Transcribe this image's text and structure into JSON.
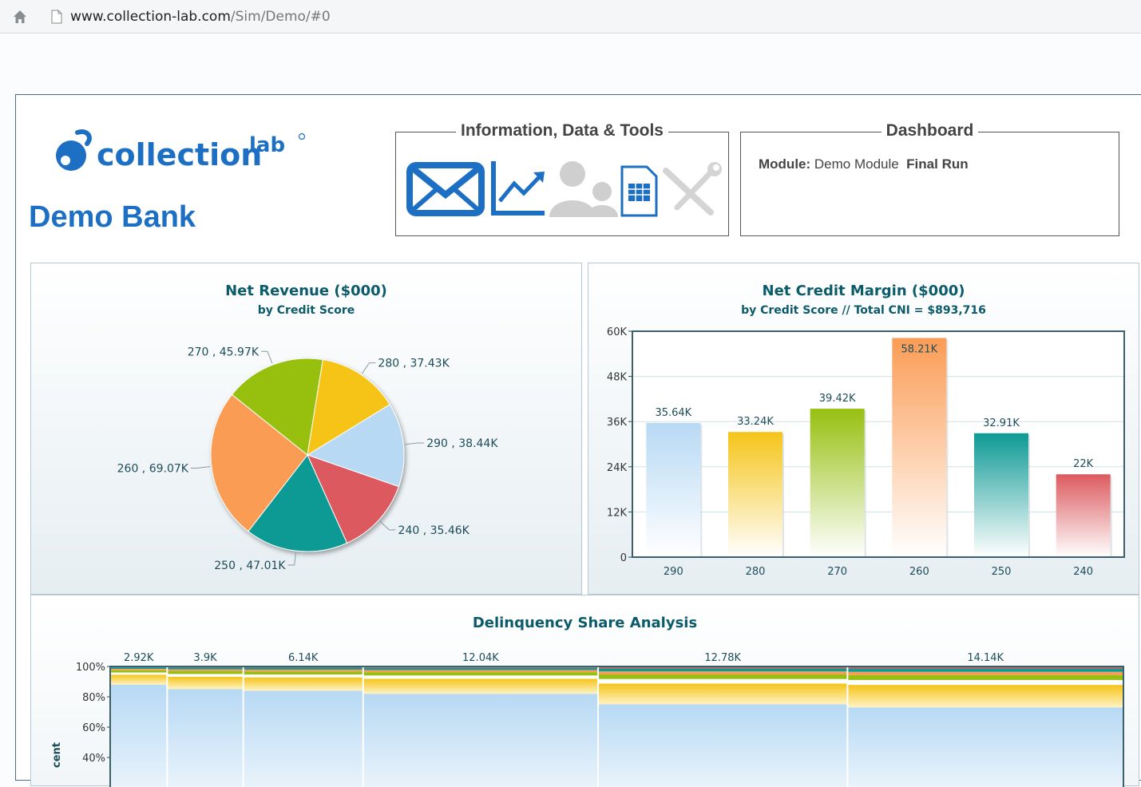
{
  "browser": {
    "url_domain": "www.collection-lab.com",
    "url_path": "/Sim/Demo/#0"
  },
  "header": {
    "logo_text": "collection",
    "logo_sup": "lab",
    "bank_name": "Demo Bank",
    "info_title": "Information, Data & Tools",
    "dashboard_title": "Dashboard",
    "module_label": "Module:",
    "module_value": "Demo Module",
    "run_label": "Final Run"
  },
  "tools": [
    "mail-icon",
    "chart-icon",
    "users-icon",
    "spreadsheet-icon",
    "tools-icon"
  ],
  "colors": {
    "brand": "#1d6fc4",
    "chart_title": "#0c5b6a",
    "s290": "#b7d9f4",
    "s280": "#f5c419",
    "s270": "#96c010",
    "s260": "#fb9c55",
    "s250": "#0e9a95",
    "s240": "#dc5a5e"
  },
  "chart_data": [
    {
      "type": "pie",
      "title": "Net Revenue ($000)",
      "subtitle": "by Credit Score",
      "slices": [
        {
          "name": "290",
          "value": 38.44,
          "label": "290 , 38.44K"
        },
        {
          "name": "240",
          "value": 35.46,
          "label": "240 , 35.46K"
        },
        {
          "name": "250",
          "value": 47.01,
          "label": "250 , 47.01K"
        },
        {
          "name": "260",
          "value": 69.07,
          "label": "260 , 69.07K"
        },
        {
          "name": "270",
          "value": 45.97,
          "label": "270 , 45.97K"
        },
        {
          "name": "280",
          "value": 37.43,
          "label": "280 , 37.43K"
        }
      ]
    },
    {
      "type": "bar",
      "title": "Net Credit Margin ($000)",
      "subtitle": "by Credit Score // Total CNI = $893,716",
      "categories": [
        "290",
        "280",
        "270",
        "260",
        "250",
        "240"
      ],
      "values": [
        35.64,
        33.24,
        39.42,
        58.21,
        32.91,
        22
      ],
      "value_labels": [
        "35.64K",
        "33.24K",
        "39.42K",
        "58.21K",
        "32.91K",
        "22K"
      ],
      "yticks": [
        "0",
        "12K",
        "24K",
        "36K",
        "48K",
        "60K"
      ],
      "ylim": [
        0,
        60
      ],
      "grid": true
    },
    {
      "type": "bar",
      "title": "Delinquency Share Analysis",
      "ylabel": "cent",
      "widths": [
        2.92,
        3.9,
        6.14,
        12.04,
        12.78,
        14.14
      ],
      "width_labels": [
        "2.92K",
        "3.9K",
        "6.14K",
        "12.04K",
        "12.78K",
        "14.14K"
      ],
      "yticks": [
        "100%",
        "80%",
        "60%",
        "40%"
      ],
      "base_share_pct": [
        88,
        85,
        84,
        82,
        75,
        73
      ]
    }
  ]
}
